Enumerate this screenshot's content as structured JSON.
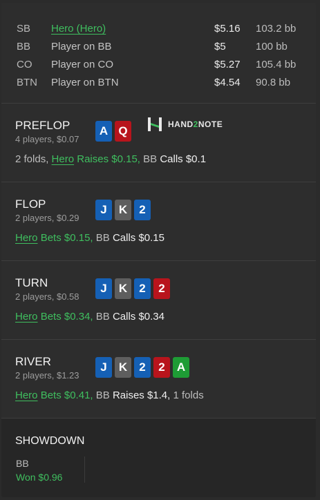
{
  "players": [
    {
      "position": "SB",
      "name": "Hero (Hero)",
      "stack": "$5.16",
      "bb": "103.2 bb",
      "hero": true
    },
    {
      "position": "BB",
      "name": "Player on BB",
      "stack": "$5",
      "bb": "100 bb"
    },
    {
      "position": "CO",
      "name": "Player on CO",
      "stack": "$5.27",
      "bb": "105.4 bb"
    },
    {
      "position": "BTN",
      "name": "Player on BTN",
      "stack": "$4.54",
      "bb": "90.8 bb"
    }
  ],
  "colors": {
    "hero_green": "#3fbf5f",
    "card_blue": "#1560b5",
    "card_red": "#b8141c",
    "card_gray": "#5e5e5e",
    "card_green": "#1e9c35"
  },
  "logo": {
    "prefix": "HAND",
    "two": "2",
    "suffix": "NOTE",
    "icon": "hand2note-logo-icon"
  },
  "streets": {
    "preflop": {
      "name": "PREFLOP",
      "sub": "4 players, $0.07",
      "cards": [
        {
          "rank": "A",
          "suit_color": "blue"
        },
        {
          "rank": "Q",
          "suit_color": "red"
        }
      ],
      "actions": {
        "folds": "2 folds,",
        "hero": "Hero",
        "hero_action": "Raises $0.15,",
        "bb": "BB",
        "bb_action": "Calls $0.1"
      }
    },
    "flop": {
      "name": "FLOP",
      "sub": "2 players, $0.29",
      "cards": [
        {
          "rank": "J",
          "suit_color": "blue"
        },
        {
          "rank": "K",
          "suit_color": "gray"
        },
        {
          "rank": "2",
          "suit_color": "blue"
        }
      ],
      "actions": {
        "hero": "Hero",
        "hero_action": "Bets $0.15,",
        "bb": "BB",
        "bb_action": "Calls $0.15"
      }
    },
    "turn": {
      "name": "TURN",
      "sub": "2 players, $0.58",
      "cards": [
        {
          "rank": "J",
          "suit_color": "blue"
        },
        {
          "rank": "K",
          "suit_color": "gray"
        },
        {
          "rank": "2",
          "suit_color": "blue"
        },
        {
          "rank": "2",
          "suit_color": "red"
        }
      ],
      "actions": {
        "hero": "Hero",
        "hero_action": "Bets $0.34,",
        "bb": "BB",
        "bb_action": "Calls $0.34"
      }
    },
    "river": {
      "name": "RIVER",
      "sub": "2 players, $1.23",
      "cards": [
        {
          "rank": "J",
          "suit_color": "blue"
        },
        {
          "rank": "K",
          "suit_color": "gray"
        },
        {
          "rank": "2",
          "suit_color": "blue"
        },
        {
          "rank": "2",
          "suit_color": "red"
        },
        {
          "rank": "A",
          "suit_color": "green"
        }
      ],
      "actions": {
        "hero": "Hero",
        "hero_action": "Bets $0.41,",
        "bb": "BB",
        "bb_action": "Raises $1.4,",
        "folds": "1 folds"
      }
    }
  },
  "showdown": {
    "title": "SHOWDOWN",
    "position": "BB",
    "result": "Won $0.96"
  }
}
